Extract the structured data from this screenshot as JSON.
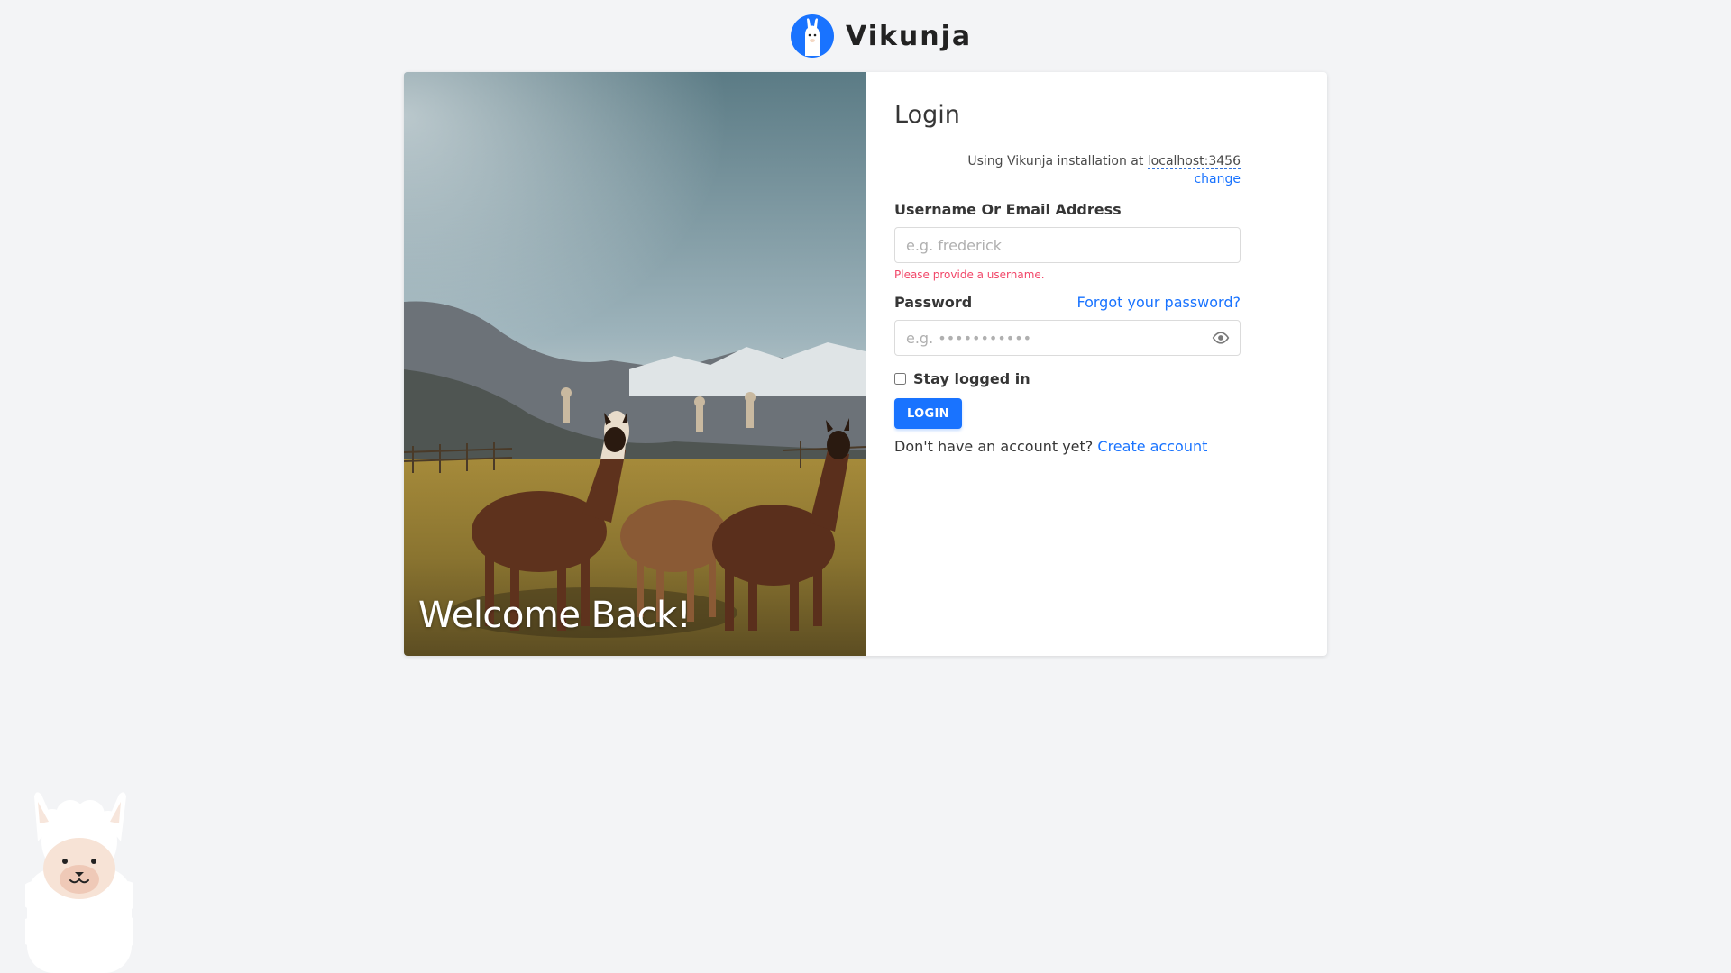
{
  "app": {
    "name": "Vikunja"
  },
  "hero": {
    "welcome_text": "Welcome Back!"
  },
  "login": {
    "title": "Login",
    "install_prefix": "Using Vikunja installation at",
    "install_url": "localhost:3456",
    "change_label": "change",
    "username_label": "Username Or Email Address",
    "username_placeholder": "e.g. frederick",
    "username_value": "",
    "username_error": "Please provide a username.",
    "password_label": "Password",
    "forgot_label": "Forgot your password?",
    "password_placeholder": "e.g. •••••••••••",
    "password_value": "",
    "stay_logged_in_label": "Stay logged in",
    "stay_logged_in_checked": false,
    "login_button_label": "LOGIN",
    "signup_prefix": "Don't have an account yet?",
    "signup_link_label": "Create account"
  },
  "icons": {
    "logo": "llama-logo-icon",
    "password_toggle": "eye-icon",
    "mascot": "llama-mascot"
  },
  "colors": {
    "primary": "#1973ff",
    "error": "#f14668",
    "background": "#f3f4f6"
  }
}
